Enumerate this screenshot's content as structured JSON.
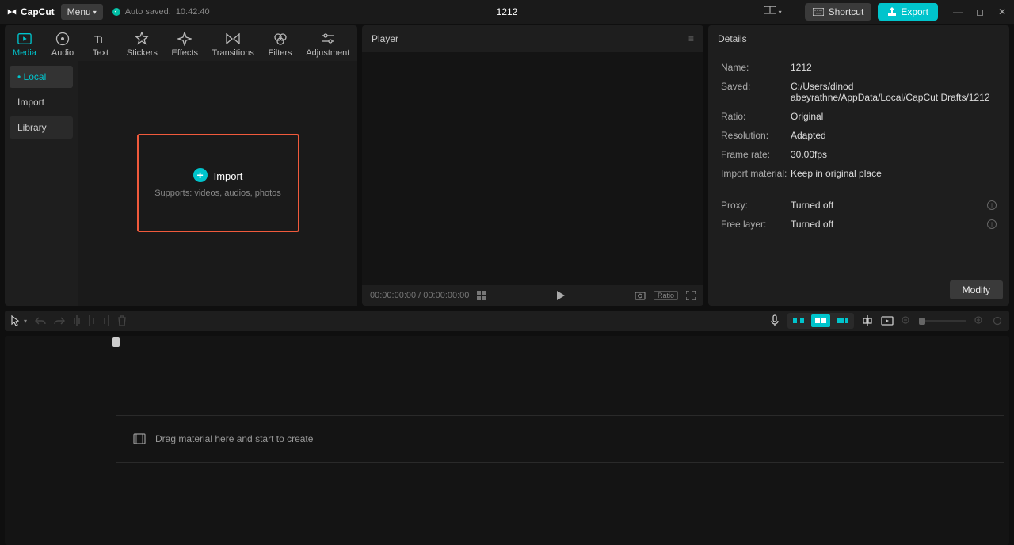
{
  "app": {
    "name": "CapCut",
    "menu_label": "Menu"
  },
  "autosave": {
    "prefix": "Auto saved:",
    "time": "10:42:40"
  },
  "project_title": "1212",
  "header": {
    "shortcut_label": "Shortcut",
    "export_label": "Export"
  },
  "tabs": [
    {
      "id": "media",
      "label": "Media"
    },
    {
      "id": "audio",
      "label": "Audio"
    },
    {
      "id": "text",
      "label": "Text"
    },
    {
      "id": "stickers",
      "label": "Stickers"
    },
    {
      "id": "effects",
      "label": "Effects"
    },
    {
      "id": "transitions",
      "label": "Transitions"
    },
    {
      "id": "filters",
      "label": "Filters"
    },
    {
      "id": "adjustment",
      "label": "Adjustment"
    }
  ],
  "sidebar": {
    "items": [
      {
        "label": "Local"
      },
      {
        "label": "Import"
      },
      {
        "label": "Library"
      }
    ]
  },
  "import_box": {
    "title": "Import",
    "subtitle": "Supports: videos, audios, photos"
  },
  "player": {
    "title": "Player",
    "time_current": "00:00:00:00",
    "time_total": "00:00:00:00",
    "ratio_label": "Ratio"
  },
  "details": {
    "title": "Details",
    "rows": {
      "name_label": "Name:",
      "name_value": "1212",
      "saved_label": "Saved:",
      "saved_value": "C:/Users/dinod abeyrathne/AppData/Local/CapCut Drafts/1212",
      "ratio_label": "Ratio:",
      "ratio_value": "Original",
      "resolution_label": "Resolution:",
      "resolution_value": "Adapted",
      "framerate_label": "Frame rate:",
      "framerate_value": "30.00fps",
      "importmat_label": "Import material:",
      "importmat_value": "Keep in original place",
      "proxy_label": "Proxy:",
      "proxy_value": "Turned off",
      "freelayer_label": "Free layer:",
      "freelayer_value": "Turned off"
    },
    "modify_label": "Modify"
  },
  "timeline": {
    "drag_hint": "Drag material here and start to create"
  }
}
